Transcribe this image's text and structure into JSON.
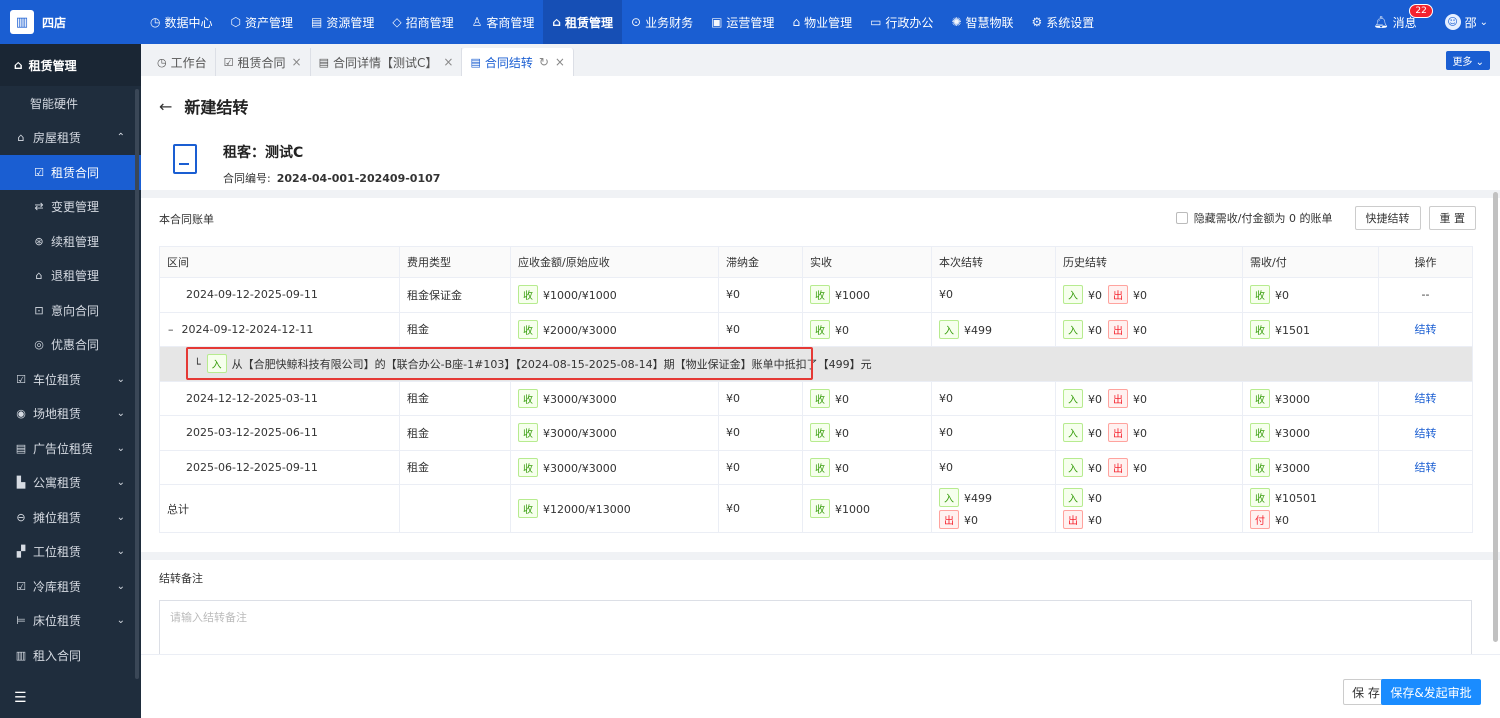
{
  "app": {
    "logo_text": "四店"
  },
  "nav": [
    {
      "icon": "◷",
      "label": "数据中心"
    },
    {
      "icon": "⬡",
      "label": "资产管理"
    },
    {
      "icon": "▤",
      "label": "资源管理"
    },
    {
      "icon": "◇",
      "label": "招商管理"
    },
    {
      "icon": "♙",
      "label": "客商管理"
    },
    {
      "icon": "⌂",
      "label": "租赁管理"
    },
    {
      "icon": "⊙",
      "label": "业务财务"
    },
    {
      "icon": "▣",
      "label": "运营管理"
    },
    {
      "icon": "⌂",
      "label": "物业管理"
    },
    {
      "icon": "▭",
      "label": "行政办公"
    },
    {
      "icon": "✺",
      "label": "智慧物联"
    },
    {
      "icon": "⚙",
      "label": "系统设置"
    }
  ],
  "top_right": {
    "message_label": "消息",
    "message_count": "22",
    "user_name": "邵"
  },
  "sidebar": {
    "header": "租赁管理",
    "items": [
      {
        "label": "智能硬件",
        "icon": ""
      },
      {
        "label": "房屋租赁",
        "icon": "⌂",
        "arrow": "⌃"
      },
      {
        "label": "租赁合同",
        "icon": "☑"
      },
      {
        "label": "变更管理",
        "icon": "⇄"
      },
      {
        "label": "续租管理",
        "icon": "⊛"
      },
      {
        "label": "退租管理",
        "icon": "⌂"
      },
      {
        "label": "意向合同",
        "icon": "⊡"
      },
      {
        "label": "优惠合同",
        "icon": "◎"
      },
      {
        "label": "车位租赁",
        "icon": "☑",
        "arrow": "⌄"
      },
      {
        "label": "场地租赁",
        "icon": "◉",
        "arrow": "⌄"
      },
      {
        "label": "广告位租赁",
        "icon": "▤",
        "arrow": "⌄"
      },
      {
        "label": "公寓租赁",
        "icon": "▙",
        "arrow": "⌄"
      },
      {
        "label": "摊位租赁",
        "icon": "⊖",
        "arrow": "⌄"
      },
      {
        "label": "工位租赁",
        "icon": "▞",
        "arrow": "⌄"
      },
      {
        "label": "冷库租赁",
        "icon": "☑",
        "arrow": "⌄"
      },
      {
        "label": "床位租赁",
        "icon": "⊨",
        "arrow": "⌄"
      },
      {
        "label": "租入合同",
        "icon": "▥"
      }
    ],
    "footer_icon": "☰"
  },
  "tabs": [
    {
      "icon": "◷",
      "label": "工作台"
    },
    {
      "icon": "☑",
      "label": "租赁合同"
    },
    {
      "icon": "▤",
      "label": "合同详情【测试C】"
    },
    {
      "icon": "▤",
      "label": "合同结转"
    }
  ],
  "more_label": "更多 ⌄",
  "page": {
    "title": "新建结转",
    "tenant_label": "租客：测试C",
    "contract_label": "合同编号:",
    "contract_no": "2024-04-001-202409-0107"
  },
  "bills": {
    "section_title": "本合同账单",
    "hide_zero_label": "隐藏需收/付金额为 0 的账单",
    "quick_btn": "快捷结转",
    "reset_btn": "重 置",
    "columns": [
      "区间",
      "费用类型",
      "应收金额/原始应收",
      "滞纳金",
      "实收",
      "本次结转",
      "历史结转",
      "需收/付",
      "操作"
    ],
    "rows": [
      {
        "period": "2024-09-12-2025-09-11",
        "type": "租金保证金",
        "receivable": "¥1000/¥1000",
        "late_fee": "¥0",
        "received": "¥1000",
        "current": "¥0",
        "hist_in": "¥0",
        "hist_out": "¥0",
        "due": "¥0",
        "action": "--"
      },
      {
        "period": "2024-09-12-2024-12-11",
        "type": "租金",
        "receivable": "¥2000/¥3000",
        "late_fee": "¥0",
        "received": "¥0",
        "current": "¥499",
        "hist_in": "¥0",
        "hist_out": "¥0",
        "due": "¥1501",
        "action": "结转",
        "toggle": "–"
      },
      {
        "period": "2024-12-12-2025-03-11",
        "type": "租金",
        "receivable": "¥3000/¥3000",
        "late_fee": "¥0",
        "received": "¥0",
        "current": "¥0",
        "hist_in": "¥0",
        "hist_out": "¥0",
        "due": "¥3000",
        "action": "结转"
      },
      {
        "period": "2025-03-12-2025-06-11",
        "type": "租金",
        "receivable": "¥3000/¥3000",
        "late_fee": "¥0",
        "received": "¥0",
        "current": "¥0",
        "hist_in": "¥0",
        "hist_out": "¥0",
        "due": "¥3000",
        "action": "结转"
      },
      {
        "period": "2025-06-12-2025-09-11",
        "type": "租金",
        "receivable": "¥3000/¥3000",
        "late_fee": "¥0",
        "received": "¥0",
        "current": "¥0",
        "hist_in": "¥0",
        "hist_out": "¥0",
        "due": "¥3000",
        "action": "结转"
      }
    ],
    "detail_row": {
      "corner": "└",
      "tag": "入",
      "text": "从【合肥快鲸科技有限公司】的【联合办公-B座-1#103】【2024-08-15-2025-08-14】期【物业保证金】账单中抵扣了【499】元"
    },
    "total": {
      "label": "总计",
      "receivable": "¥12000/¥13000",
      "late_fee": "¥0",
      "received": "¥1000",
      "current_in": "¥499",
      "current_out": "¥0",
      "hist_in": "¥0",
      "hist_out": "¥0",
      "due_in": "¥10501",
      "due_out": "¥0"
    },
    "tags": {
      "receive": "收",
      "in": "入",
      "out": "出",
      "pay": "付"
    }
  },
  "remark": {
    "title": "结转备注",
    "placeholder": "请输入结转备注"
  },
  "footer": {
    "save": "保 存",
    "submit": "保存&发起审批"
  }
}
